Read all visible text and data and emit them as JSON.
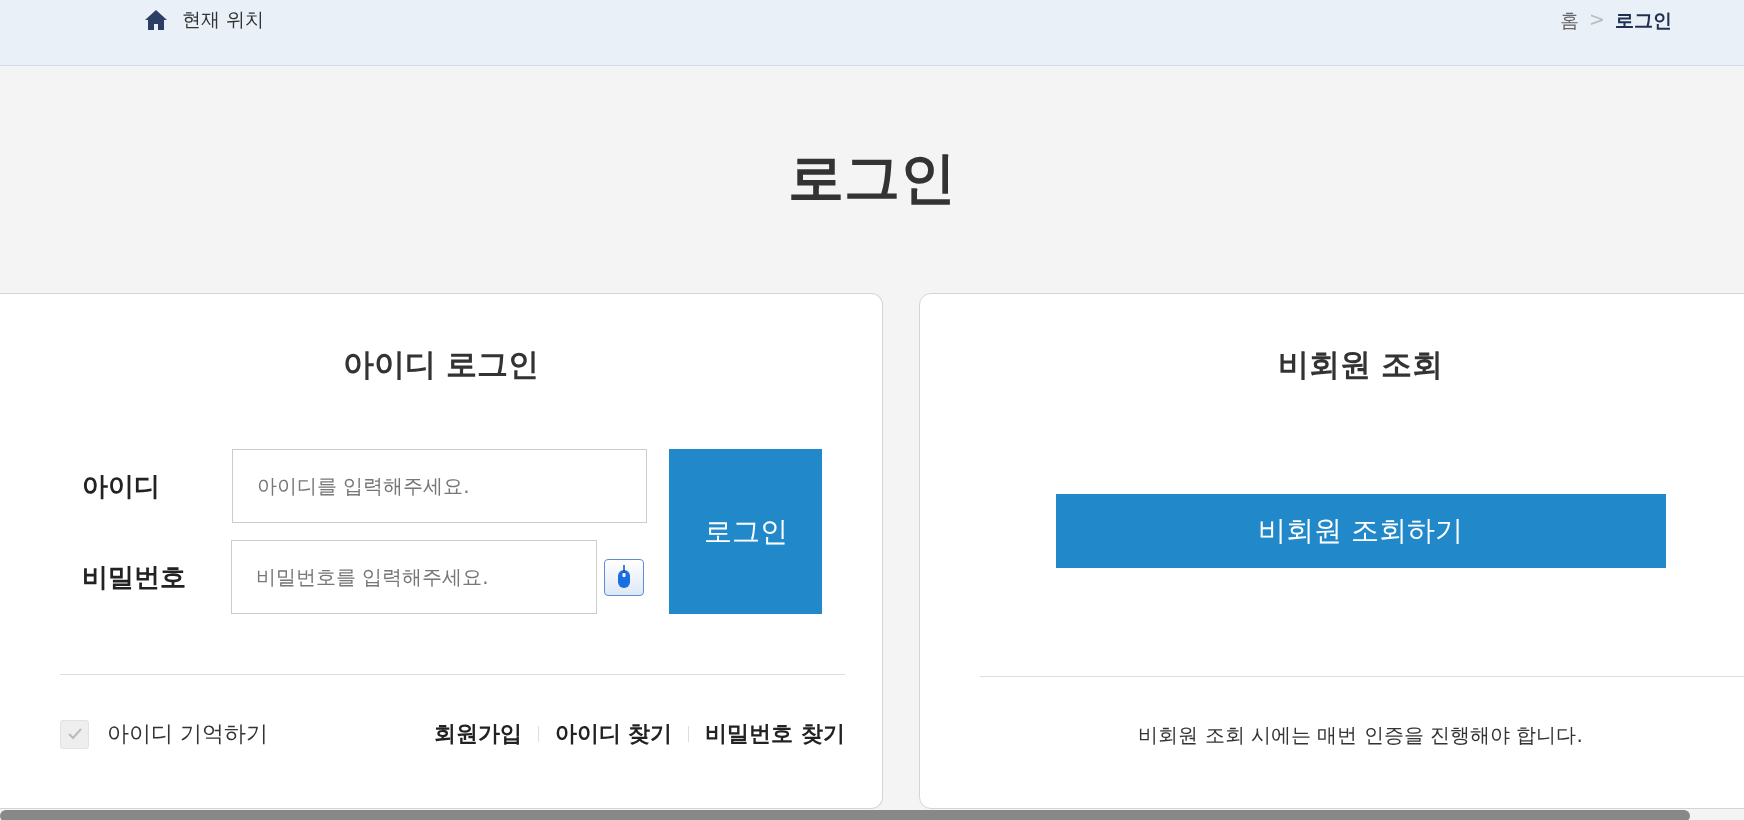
{
  "location_bar": {
    "label": "현재 위치",
    "breadcrumb": [
      "홈",
      ">",
      "로그인"
    ]
  },
  "page_title": "로그인",
  "id_login": {
    "title": "아이디 로그인",
    "fields": [
      {
        "label": "아이디",
        "placeholder": "아이디를 입력해주세요.",
        "kind": "text"
      },
      {
        "label": "비밀번호",
        "placeholder": "비밀번호를 입력해주세요.",
        "kind": "password"
      }
    ],
    "login_button": "로그인",
    "remember_id": {
      "label": "아이디 기억하기",
      "checked": true
    },
    "links": [
      "회원가입",
      "아이디 찾기",
      "비밀번호 찾기"
    ]
  },
  "guest_lookup": {
    "title": "비회원 조회",
    "button": "비회원 조회하기",
    "note": "비회원 조회 시에는 매번 인증을 진행해야 합니다."
  }
}
